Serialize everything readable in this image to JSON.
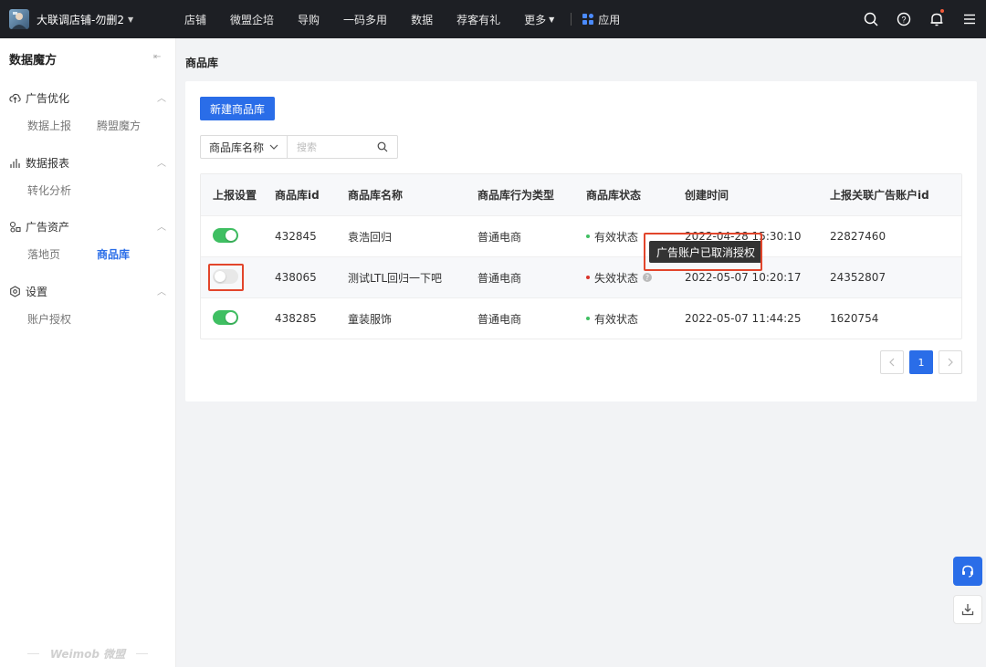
{
  "topbar": {
    "shop_name": "大联调店铺-勿删2",
    "nav": [
      "店铺",
      "微盟企培",
      "导购",
      "一码多用",
      "数据",
      "荐客有礼"
    ],
    "more_label": "更多",
    "apps_label": "应用"
  },
  "sidebar": {
    "title": "数据魔方",
    "groups": [
      {
        "label": "广告优化",
        "items": [
          "数据上报",
          "腾盟魔方"
        ]
      },
      {
        "label": "数据报表",
        "items": [
          "转化分析"
        ]
      },
      {
        "label": "广告资产",
        "items": [
          "落地页",
          "商品库"
        ]
      },
      {
        "label": "设置",
        "items": [
          "账户授权"
        ]
      }
    ],
    "brand": "Weimob 微盟"
  },
  "breadcrumb": "商品库",
  "toolbar": {
    "new_button": "新建商品库",
    "filter_select": "商品库名称",
    "search_placeholder": "搜索"
  },
  "table": {
    "columns": [
      "上报设置",
      "商品库id",
      "商品库名称",
      "商品库行为类型",
      "商品库状态",
      "创建时间",
      "上报关联广告账户id"
    ],
    "rows": [
      {
        "report_on": true,
        "id": "432845",
        "name": "袁浩回归",
        "type": "普通电商",
        "status": "有效状态",
        "created": "2022-04-28 15:30:10",
        "account_id": "22827460"
      },
      {
        "report_on": false,
        "id": "438065",
        "name": "测试LTL回归一下吧",
        "type": "普通电商",
        "status": "失效状态",
        "created": "2022-05-07 10:20:17",
        "account_id": "24352807"
      },
      {
        "report_on": true,
        "id": "438285",
        "name": "童装服饰",
        "type": "普通电商",
        "status": "有效状态",
        "created": "2022-05-07 11:44:25",
        "account_id": "1620754"
      }
    ]
  },
  "tooltip": "广告账户已取消授权",
  "pagination": {
    "current": "1"
  },
  "colors": {
    "primary": "#2a6de8",
    "valid": "#3fbf62",
    "invalid": "#d9342b",
    "highlight": "#e2452b"
  }
}
